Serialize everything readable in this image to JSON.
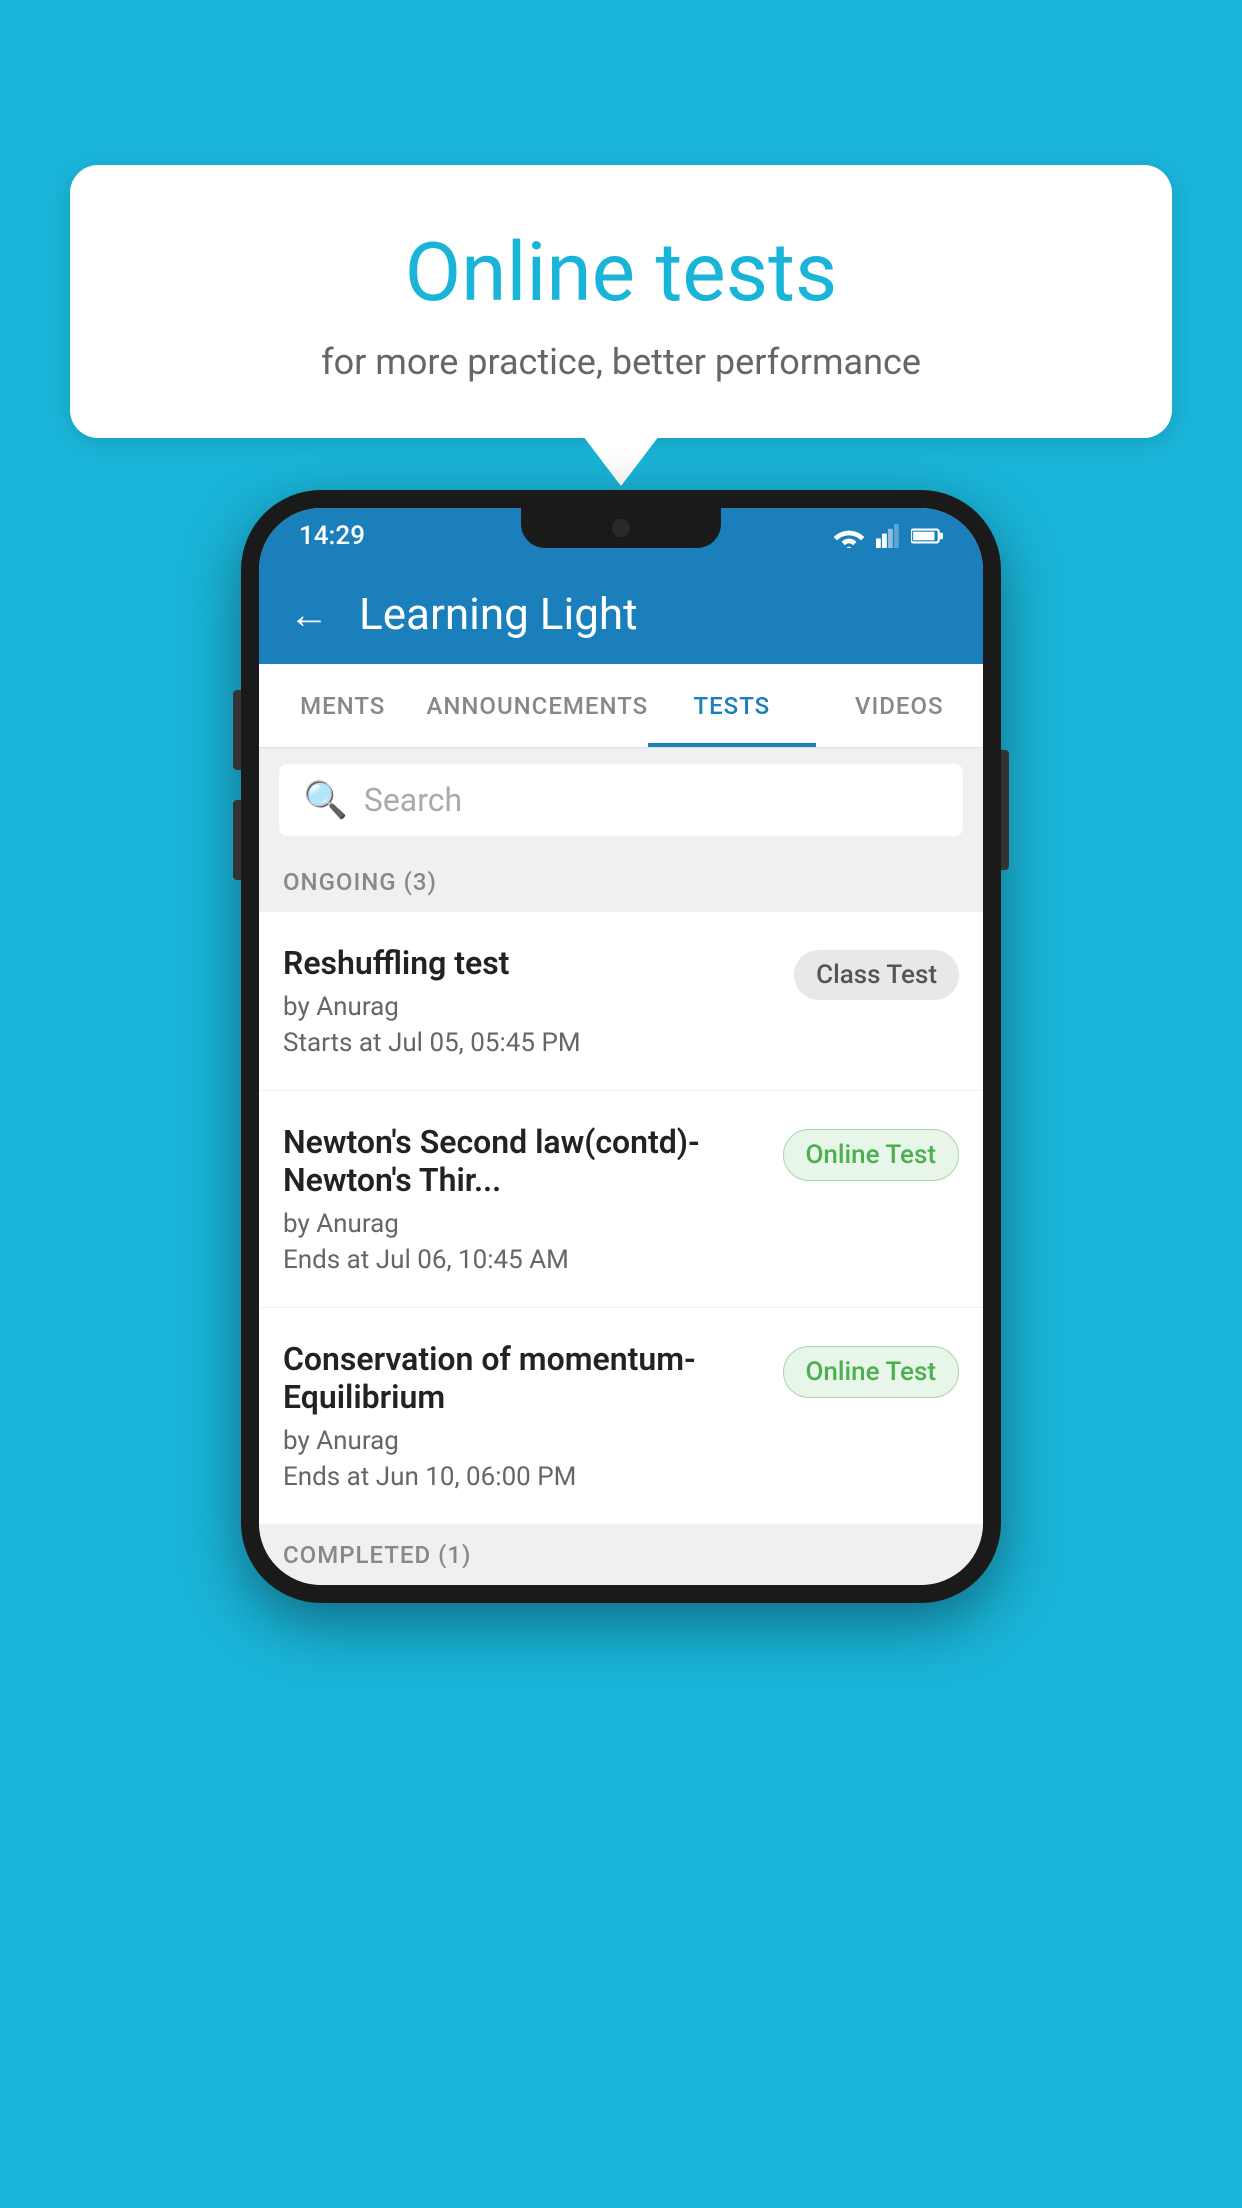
{
  "background_color": "#1ab4d8",
  "speech_bubble": {
    "title": "Online tests",
    "subtitle": "for more practice, better performance"
  },
  "phone": {
    "status_bar": {
      "time": "14:29",
      "wifi": true,
      "signal": true,
      "battery": true
    },
    "app_bar": {
      "title": "Learning Light",
      "back_label": "←"
    },
    "tabs": [
      {
        "label": "MENTS",
        "active": false
      },
      {
        "label": "ANNOUNCEMENTS",
        "active": false
      },
      {
        "label": "TESTS",
        "active": true
      },
      {
        "label": "VIDEOS",
        "active": false
      }
    ],
    "search": {
      "placeholder": "Search"
    },
    "ongoing_section": {
      "label": "ONGOING (3)"
    },
    "tests": [
      {
        "name": "Reshuffling test",
        "by": "by Anurag",
        "date": "Starts at  Jul 05, 05:45 PM",
        "badge": "Class Test",
        "badge_type": "class"
      },
      {
        "name": "Newton's Second law(contd)-Newton's Thir...",
        "by": "by Anurag",
        "date": "Ends at  Jul 06, 10:45 AM",
        "badge": "Online Test",
        "badge_type": "online"
      },
      {
        "name": "Conservation of momentum-Equilibrium",
        "by": "by Anurag",
        "date": "Ends at  Jun 10, 06:00 PM",
        "badge": "Online Test",
        "badge_type": "online"
      }
    ],
    "completed_section": {
      "label": "COMPLETED (1)"
    }
  }
}
